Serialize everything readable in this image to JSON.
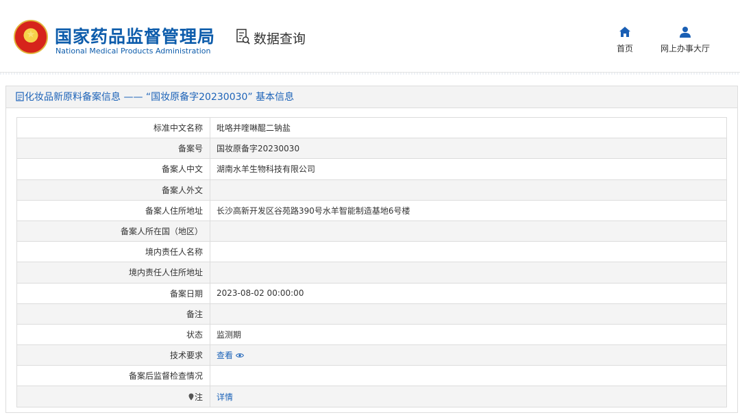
{
  "header": {
    "agency_cn": "国家药品监督管理局",
    "agency_en": "National Medical Products Administration",
    "system_title": "数据查询",
    "nav": [
      {
        "label": "首页",
        "icon": "home-icon"
      },
      {
        "label": "网上办事大厅",
        "icon": "user-icon"
      }
    ]
  },
  "panel": {
    "title": "化妆品新原料备案信息 —— “国妆原备字20230030” 基本信息"
  },
  "rows": [
    {
      "label": "标准中文名称",
      "value": "吡咯并喹啉醌二钠盐"
    },
    {
      "label": "备案号",
      "value": "国妆原备字20230030"
    },
    {
      "label": "备案人中文",
      "value": "湖南水羊生物科技有限公司"
    },
    {
      "label": "备案人外文",
      "value": ""
    },
    {
      "label": "备案人住所地址",
      "value": "长沙高新开发区谷苑路390号水羊智能制造基地6号楼"
    },
    {
      "label": "备案人所在国（地区）",
      "value": ""
    },
    {
      "label": "境内责任人名称",
      "value": ""
    },
    {
      "label": "境内责任人住所地址",
      "value": ""
    },
    {
      "label": "备案日期",
      "value": "2023-08-02 00:00:00"
    },
    {
      "label": "备注",
      "value": ""
    },
    {
      "label": "状态",
      "value": "监测期"
    },
    {
      "label": "技术要求",
      "value": "查看"
    },
    {
      "label": "备案后监督检查情况",
      "value": ""
    },
    {
      "label": "注",
      "value": "详情"
    }
  ],
  "colors": {
    "brand": "#0d5cab",
    "link": "#1d63b8",
    "border": "#dcdcdc",
    "row_alt": "#f4f4f4"
  }
}
